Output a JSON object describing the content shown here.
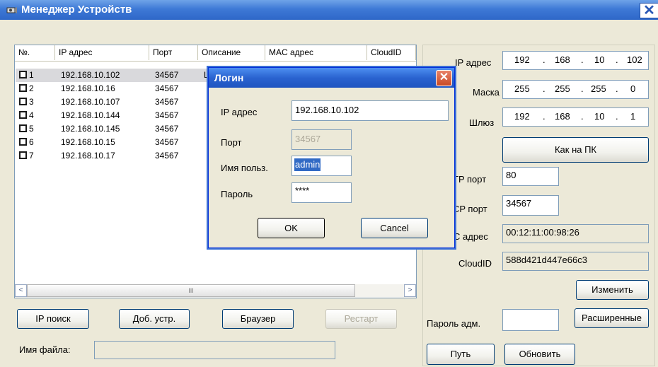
{
  "window": {
    "title": "Менеджер Устройств",
    "close_glyph": "✕"
  },
  "table": {
    "columns": [
      "№.",
      "IP адрес",
      "Порт",
      "Описание",
      "MAC адрес",
      "CloudID"
    ],
    "rows": [
      {
        "no": "1",
        "ip": "192.168.10.102",
        "port": "34567",
        "desc": "L"
      },
      {
        "no": "2",
        "ip": "192.168.10.16",
        "port": "34567",
        "desc": ""
      },
      {
        "no": "3",
        "ip": "192.168.10.107",
        "port": "34567",
        "desc": ""
      },
      {
        "no": "4",
        "ip": "192.168.10.144",
        "port": "34567",
        "desc": ""
      },
      {
        "no": "5",
        "ip": "192.168.10.145",
        "port": "34567",
        "desc": ""
      },
      {
        "no": "6",
        "ip": "192.168.10.15",
        "port": "34567",
        "desc": ""
      },
      {
        "no": "7",
        "ip": "192.168.10.17",
        "port": "34567",
        "desc": ""
      }
    ],
    "scroll_left": "<",
    "scroll_right": ">",
    "scroll_grip": "III"
  },
  "buttons": {
    "ip_search": "IP поиск",
    "add_device": "Доб. устр.",
    "browser": "Браузер",
    "restart": "Рестарт",
    "like_pc": "Как на ПК",
    "change": "Изменить",
    "advanced": "Расширенные",
    "path": "Путь",
    "update": "Обновить"
  },
  "file": {
    "label": "Имя файла:",
    "value": ""
  },
  "network": {
    "ip_label": "IP адрес",
    "ip": [
      "192",
      "168",
      "10",
      "102"
    ],
    "mask_label": "Маска",
    "mask": [
      "255",
      "255",
      "255",
      "0"
    ],
    "gateway_label": "Шлюз",
    "gateway": [
      "192",
      "168",
      "10",
      "1"
    ],
    "http_label": "TP порт",
    "http": "80",
    "tcp_label": "CP порт",
    "tcp": "34567",
    "mac_label": "C адрес",
    "mac": "00:12:11:00:98:26",
    "cloud_label": "CloudID",
    "cloud": "588d421d447e66c3",
    "admin_pwd_label": "Пароль адм.",
    "admin_pwd": ""
  },
  "login": {
    "title": "Логин",
    "ip_label": "IP адрес",
    "ip": "192.168.10.102",
    "port_label": "Порт",
    "port": "34567",
    "user_label": "Имя польз.",
    "user": "admin",
    "pwd_label": "Пароль",
    "pwd": "****",
    "ok": "OK",
    "cancel": "Cancel",
    "close_glyph": "✕"
  }
}
